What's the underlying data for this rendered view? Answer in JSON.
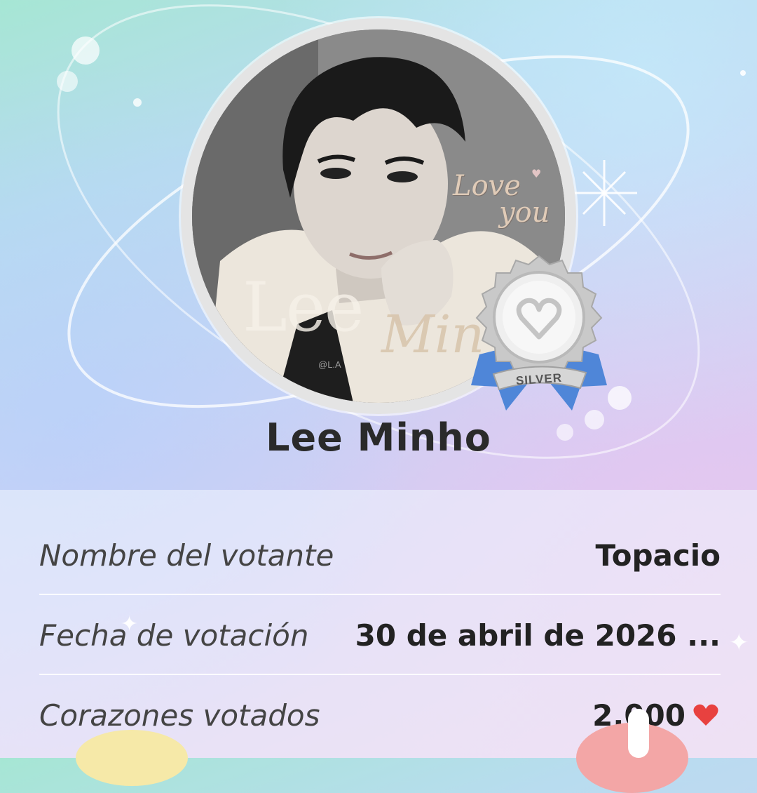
{
  "artist": {
    "name": "Lee Minho"
  },
  "photo": {
    "overlay_text_1": "Lee",
    "overlay_text_2": "Min",
    "love_line_1": "Love",
    "love_line_2": "you",
    "watermark": "@L.A"
  },
  "badge": {
    "label": "SILVER",
    "icon": "heart-ribbon-medal"
  },
  "details": [
    {
      "label": "Nombre del votante",
      "value": "Topacio"
    },
    {
      "label": "Fecha de votación",
      "value": "30 de abril de 2026 ..."
    },
    {
      "label": "Corazones votados",
      "value": "2,000",
      "icon": "heart-icon"
    }
  ],
  "colors": {
    "heart": "#e8413f",
    "badge_ribbon": "#4f86d8",
    "badge_silver": "#d8d8d8",
    "text_dark": "#222222"
  }
}
